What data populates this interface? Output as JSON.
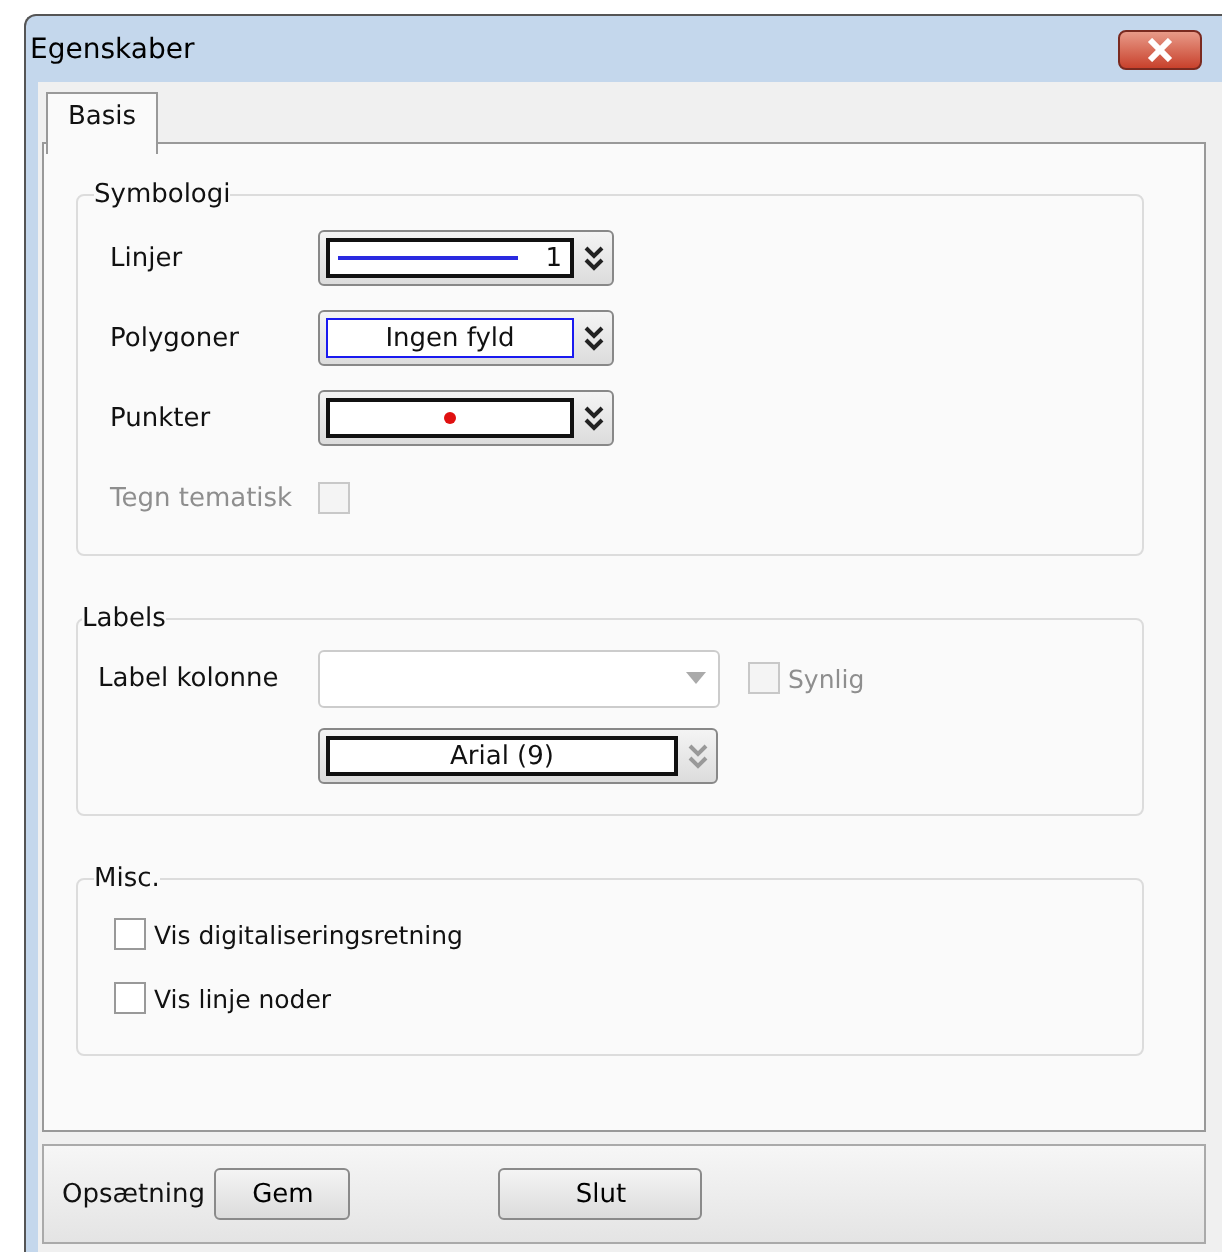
{
  "window": {
    "title": "Egenskaber"
  },
  "tabs": [
    {
      "label": "Basis",
      "selected": true
    }
  ],
  "symbologi": {
    "title": "Symbologi",
    "rows": [
      {
        "kind": "line",
        "label": "Linjer",
        "color": "#2a2ae0",
        "value": "1"
      },
      {
        "kind": "fill",
        "label": "Polygoner",
        "color": "#1a1af0",
        "value": "Ingen fyld"
      },
      {
        "kind": "point",
        "label": "Punkter",
        "color": "#e01010"
      }
    ],
    "thematic": {
      "label": "Tegn tematisk",
      "checked": false,
      "disabled": true
    }
  },
  "labels": {
    "title": "Labels",
    "column_label": "Label kolonne",
    "column_disabled": true,
    "visible": {
      "label": "Synlig",
      "checked": false,
      "disabled": true
    },
    "font": {
      "value": "Arial (9)",
      "disabled": true
    }
  },
  "misc": {
    "title": "Misc.",
    "options": [
      {
        "label": "Vis digitaliseringsretning",
        "checked": false
      },
      {
        "label": "Vis linje noder",
        "checked": false
      }
    ]
  },
  "footer": {
    "label": "Opsætning",
    "buttons": [
      "Gem",
      "Slut"
    ]
  }
}
